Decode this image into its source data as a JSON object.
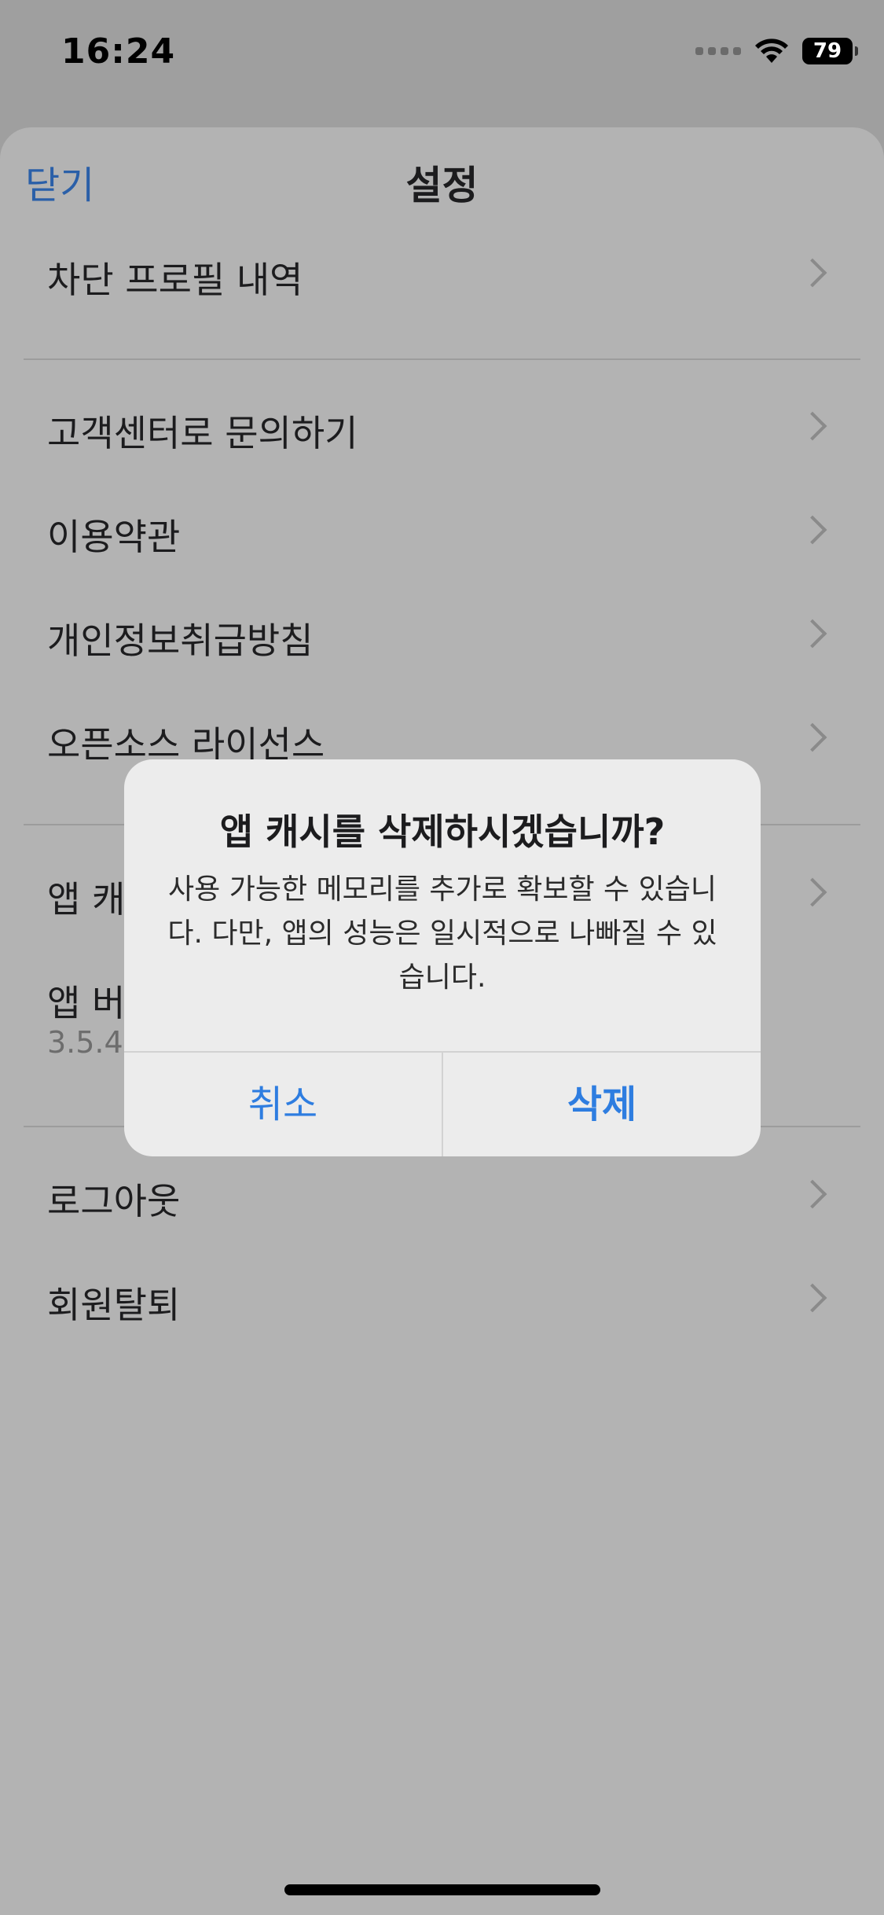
{
  "status_bar": {
    "time": "16:24",
    "battery": "79",
    "icons": [
      "signal-dots-icon",
      "wifi-icon",
      "battery-icon"
    ]
  },
  "sheet": {
    "close_label": "닫기",
    "title": "설정",
    "rows": [
      {
        "label": "차단 프로필 내역"
      },
      {
        "label": "고객센터로 문의하기"
      },
      {
        "label": "이용약관"
      },
      {
        "label": "개인정보취급방침"
      },
      {
        "label": "오픈소스 라이선스"
      },
      {
        "label": "앱 캐"
      },
      {
        "label": "앱 버",
        "sub": "3.5.4"
      },
      {
        "label": "로그아웃"
      },
      {
        "label": "회원탈퇴"
      }
    ]
  },
  "alert": {
    "title": "앱 캐시를 삭제하시겠습니까?",
    "message": "사용 가능한 메모리를 추가로 확보할 수 있습니다. 다만, 앱의 성능은 일시적으로 나빠질 수 있습니다.",
    "cancel_label": "취소",
    "delete_label": "삭제"
  },
  "colors": {
    "accent": "#2e7de0",
    "link": "#2a5fa8",
    "overlay_background": "#b3b3b3",
    "alert_background": "#ececec"
  }
}
